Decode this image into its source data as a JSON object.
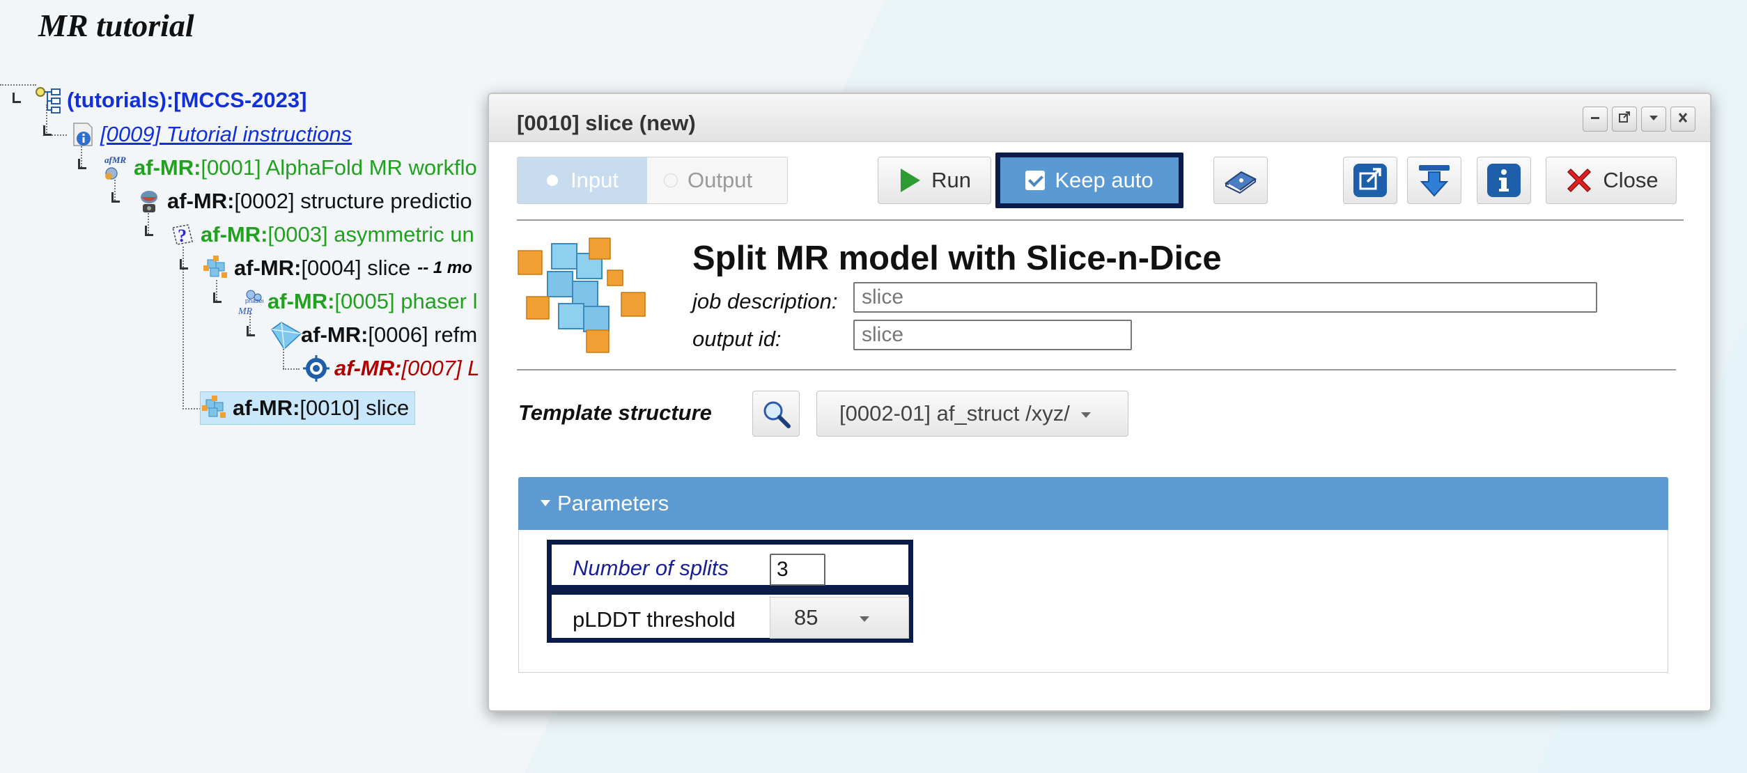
{
  "page": {
    "title": "MR tutorial"
  },
  "tree": {
    "root": "(tutorials):[MCCS-2023]",
    "nodes": [
      {
        "text": "[0009] Tutorial instructions"
      },
      {
        "prefix": "af-MR:",
        "text": "[0001] AlphaFold MR workflo"
      },
      {
        "prefix": "af-MR:",
        "text": "[0002] structure predictio"
      },
      {
        "prefix": "af-MR:",
        "text": "[0003] asymmetric un"
      },
      {
        "prefix": "af-MR:",
        "text": "[0004] slice",
        "note": "-- 1 mo"
      },
      {
        "prefix": "af-MR:",
        "text": "[0005] phaser l"
      },
      {
        "prefix": "af-MR:",
        "text": "[0006] refm"
      },
      {
        "prefix": "af-MR:",
        "text": "[0007] L"
      },
      {
        "prefix": "af-MR:",
        "text": "[0010] slice"
      }
    ]
  },
  "dialog": {
    "title": "[0010] slice (new)",
    "tabs": {
      "input": "Input",
      "output": "Output"
    },
    "buttons": {
      "run": "Run",
      "keep_auto": "Keep auto",
      "close": "Close"
    },
    "job_title": "Split MR model with Slice-n-Dice",
    "job_description_label": "job description:",
    "job_description_value": "slice",
    "output_id_label": "output id:",
    "output_id_value": "slice",
    "template_label": "Template structure",
    "template_value": "[0002-01] af_struct /xyz/",
    "parameters_header": "Parameters",
    "num_splits_label": "Number of splits",
    "num_splits_value": "3",
    "plddt_label": "pLDDT threshold",
    "plddt_value": "85"
  }
}
